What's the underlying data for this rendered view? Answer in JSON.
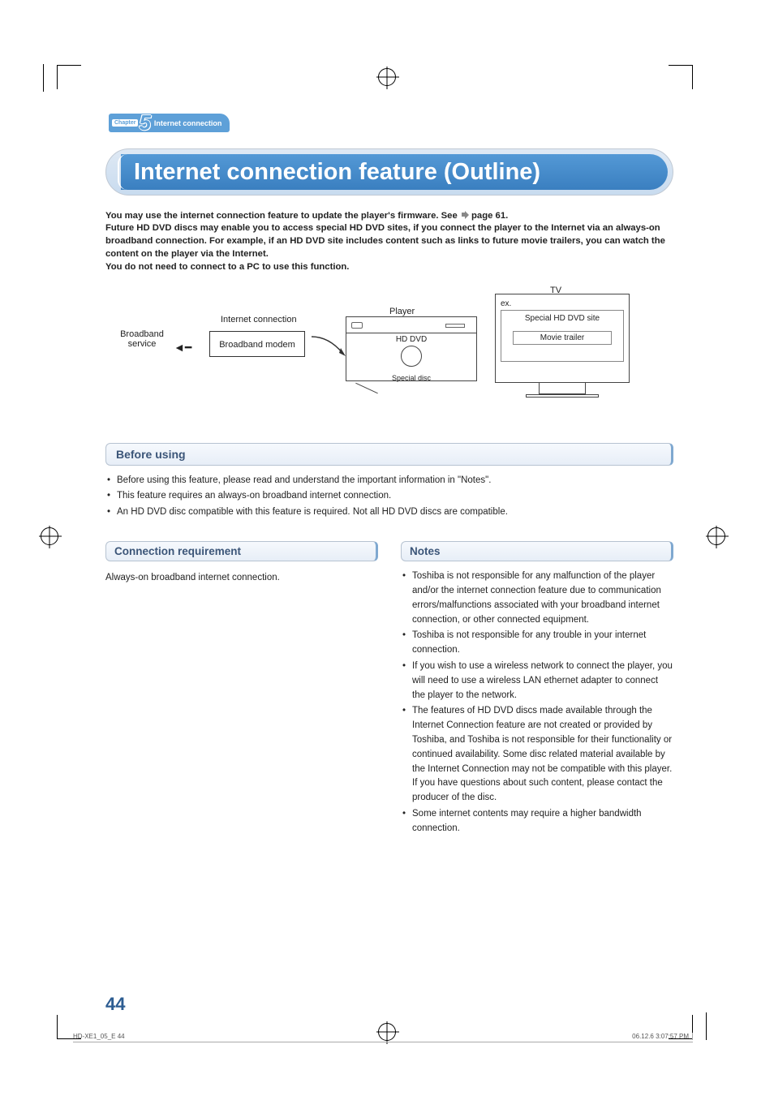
{
  "chapter": {
    "word": "Chapter",
    "number": "5",
    "label": "Internet connection"
  },
  "title": "Internet connection feature (Outline)",
  "intro": {
    "line1a": "You may use the internet connection feature to update the player's firmware. See ",
    "line1b": " page 61.",
    "line2": "Future HD DVD discs may enable you to access special HD DVD sites, if you connect the player to the Internet via an always-on broadband connection. For example, if an HD DVD site includes content such as links to future movie trailers, you can watch the content on the player via the Internet.",
    "line3": "You do not need to connect to a PC to use this function."
  },
  "diagram": {
    "broadband_service": "Broadband service",
    "internet_connection": "Internet connection",
    "broadband_modem": "Broadband modem",
    "player": "Player",
    "hd_dvd": "HD DVD",
    "special_disc": "Special disc",
    "tv": "TV",
    "ex": "ex.",
    "special_site": "Special HD DVD site",
    "movie_trailer": "Movie trailer"
  },
  "sections": {
    "before_using": {
      "title": "Before using",
      "items": [
        "Before using this feature, please read and understand the important information in \"Notes\".",
        "This feature requires an always-on broadband internet connection.",
        "An HD DVD disc compatible with this feature is required. Not all HD DVD discs are compatible."
      ]
    },
    "connection_requirement": {
      "title": "Connection requirement",
      "body": "Always-on broadband internet connection."
    },
    "notes": {
      "title": "Notes",
      "items": [
        "Toshiba is not responsible for any malfunction of the player and/or the internet connection feature due to communication errors/malfunctions associated with your broadband internet connection, or other connected equipment.",
        "Toshiba is not responsible for any trouble in your internet connection.",
        "If you wish to use a wireless network to connect the player, you will need to use a wireless LAN ethernet adapter to connect the player to the network.",
        "The features of HD DVD discs made available through the Internet Connection feature are not created or provided by Toshiba, and Toshiba is not responsible for their functionality or continued availability. Some disc related material available by the Internet Connection may not be compatible with this player. If you have questions about such content, please contact the producer of the disc.",
        "Some internet contents may require a higher bandwidth connection."
      ]
    }
  },
  "page_number": "44",
  "footer": {
    "left": "HD-XE1_05_E   44",
    "right": "06.12.6   3:07:57 PM"
  }
}
